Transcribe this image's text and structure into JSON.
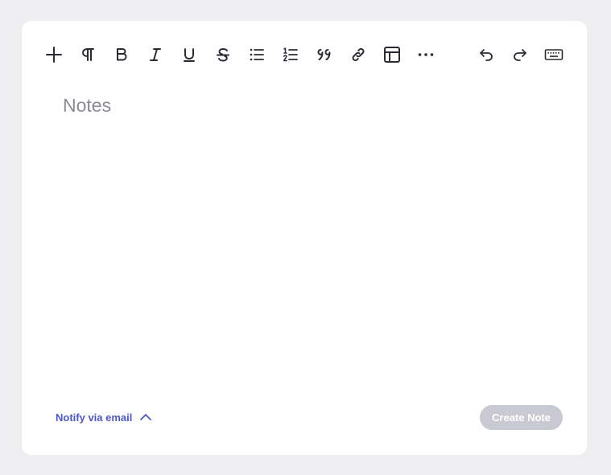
{
  "toolbar": {
    "buttons": [
      {
        "name": "plus-icon",
        "label": "Insert"
      },
      {
        "name": "pilcrow-icon",
        "label": "Paragraph"
      },
      {
        "name": "bold-icon",
        "label": "Bold"
      },
      {
        "name": "italic-icon",
        "label": "Italic"
      },
      {
        "name": "underline-icon",
        "label": "Underline"
      },
      {
        "name": "strikethrough-icon",
        "label": "Strikethrough"
      },
      {
        "name": "bullet-list-icon",
        "label": "Bulleted list"
      },
      {
        "name": "numbered-list-icon",
        "label": "Numbered list"
      },
      {
        "name": "quote-icon",
        "label": "Quote"
      },
      {
        "name": "link-icon",
        "label": "Link"
      },
      {
        "name": "table-icon",
        "label": "Table"
      },
      {
        "name": "more-icon",
        "label": "More"
      },
      {
        "name": "undo-icon",
        "label": "Undo"
      },
      {
        "name": "redo-icon",
        "label": "Redo"
      },
      {
        "name": "keyboard-icon",
        "label": "Keyboard shortcuts"
      }
    ]
  },
  "editor": {
    "placeholder": "Notes"
  },
  "footer": {
    "notify_label": "Notify via email",
    "notify_icon": "chevron-up-icon",
    "create_label": "Create Note"
  },
  "colors": {
    "background": "#eeeef0",
    "card": "#ffffff",
    "icon": "#2b2b36",
    "accent": "#4c57c4",
    "disabled_button": "#c9c9d4",
    "placeholder": "#8a8a96"
  }
}
